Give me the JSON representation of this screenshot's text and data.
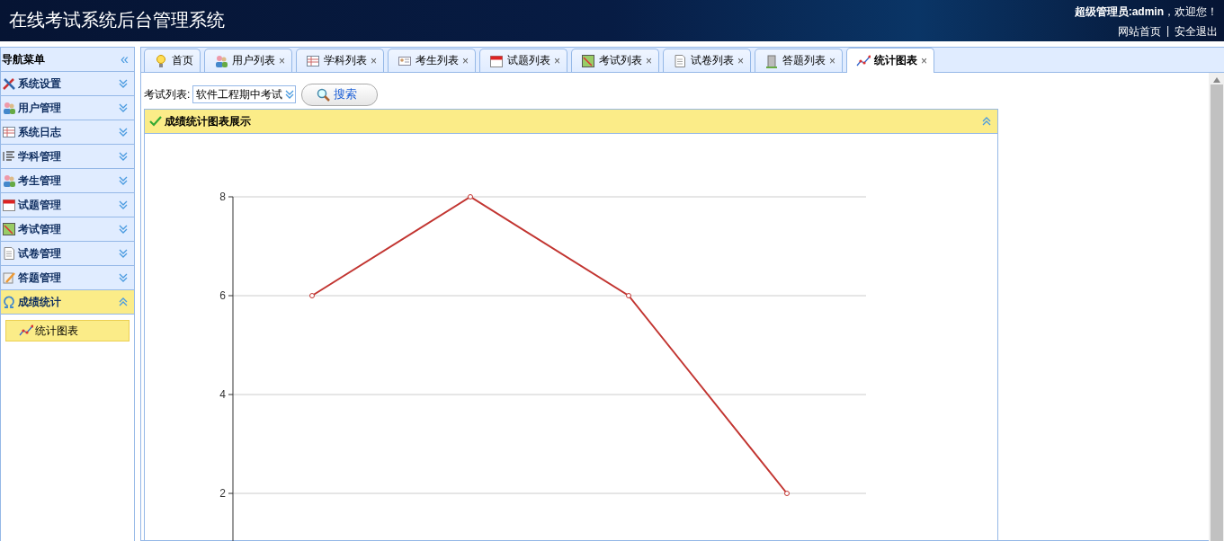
{
  "header": {
    "title": "在线考试系统后台管理系统",
    "greeting": "**超级管理员:admin**，欢迎您！",
    "links": [
      "网站首页",
      "安全退出"
    ],
    "separator": "|"
  },
  "sidebar": {
    "title": "导航菜单",
    "collapse_glyph": "«",
    "items": [
      {
        "label": "系统设置",
        "expanded": false
      },
      {
        "label": "用户管理",
        "expanded": false
      },
      {
        "label": "系统日志",
        "expanded": false
      },
      {
        "label": "学科管理",
        "expanded": false
      },
      {
        "label": "考生管理",
        "expanded": false
      },
      {
        "label": "试题管理",
        "expanded": false
      },
      {
        "label": "考试管理",
        "expanded": false
      },
      {
        "label": "试卷管理",
        "expanded": false
      },
      {
        "label": "答题管理",
        "expanded": false
      },
      {
        "label": "成绩统计",
        "expanded": true,
        "children": [
          {
            "label": "统计图表",
            "selected": true
          }
        ]
      }
    ]
  },
  "tabs": [
    {
      "label": "首页",
      "closable": false,
      "selected": false
    },
    {
      "label": "用户列表",
      "closable": true,
      "selected": false
    },
    {
      "label": "学科列表",
      "closable": true,
      "selected": false
    },
    {
      "label": "考生列表",
      "closable": true,
      "selected": false
    },
    {
      "label": "试题列表",
      "closable": true,
      "selected": false
    },
    {
      "label": "考试列表",
      "closable": true,
      "selected": false
    },
    {
      "label": "试卷列表",
      "closable": true,
      "selected": false
    },
    {
      "label": "答题列表",
      "closable": true,
      "selected": false
    },
    {
      "label": "统计图表",
      "closable": true,
      "selected": true
    }
  ],
  "close_glyph": "×",
  "filter": {
    "label": "考试列表:",
    "value": "软件工程期中考试",
    "button": "搜索"
  },
  "panel": {
    "title": "成绩统计图表展示",
    "chart_data": {
      "type": "line",
      "series": [
        {
          "color": "#c23531",
          "marker": "circle",
          "values": [
            6,
            8,
            6,
            2
          ]
        }
      ],
      "grid": true,
      "ylim": [
        0,
        8
      ],
      "yticks": [
        2,
        4,
        6,
        8
      ]
    }
  }
}
